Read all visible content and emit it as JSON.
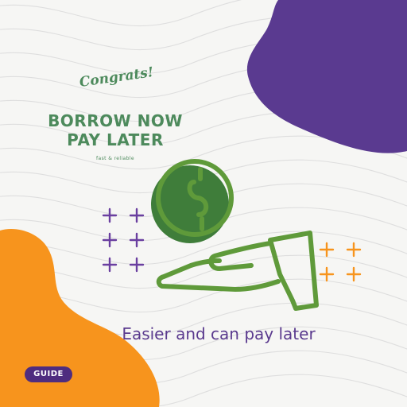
{
  "colors": {
    "background": "#f6f6f4",
    "purple": "#5a3a90",
    "orange": "#f7941d",
    "green": "#5f9a3a",
    "dark_green": "#3f7d3a",
    "badge": "#4f2d7f"
  },
  "heading": {
    "congrats": "Congrats!",
    "line1": "BORROW NOW",
    "line2": "PAY LATER",
    "tagline": "fast & reliable"
  },
  "illustration": {
    "coin_icon": "dollar-coin-icon",
    "hand_icon": "open-hand-icon",
    "sparkle_icon": "plus-icon"
  },
  "caption": "Easier and can pay later",
  "badge": {
    "label": "GUIDE"
  }
}
